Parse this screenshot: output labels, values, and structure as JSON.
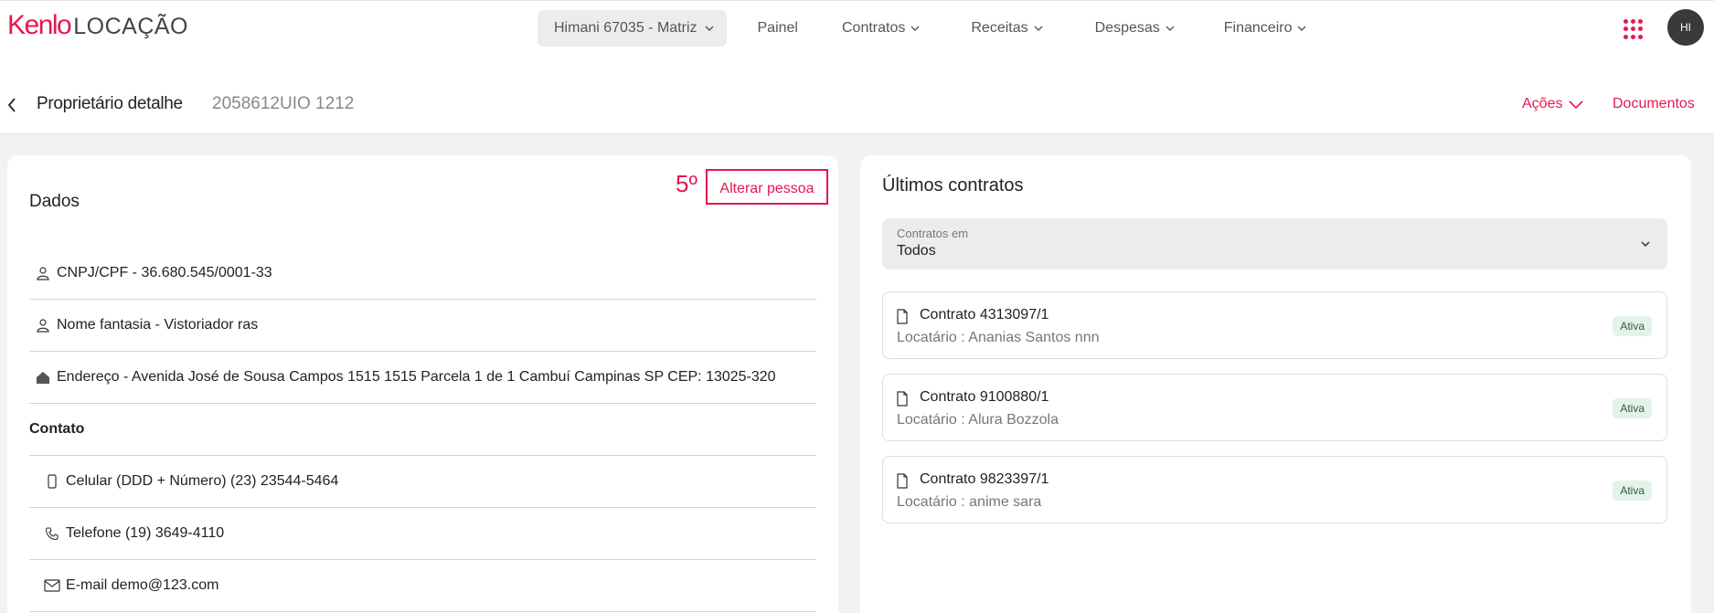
{
  "brand": {
    "name": "Kenlo",
    "product": "LOCAÇÃO"
  },
  "nav": {
    "branch": "Himani 67035 - Matriz",
    "items": [
      "Painel",
      "Contratos",
      "Receitas",
      "Despesas",
      "Financeiro"
    ]
  },
  "user": {
    "initials": "HI"
  },
  "header": {
    "title": "Proprietário detalhe",
    "code": "2058612UIO 1212",
    "actions_label": "Ações",
    "documents_label": "Documentos"
  },
  "dados": {
    "title": "Dados",
    "step": "5º",
    "change_person": "Alterar pessoa",
    "cnpj": "CNPJ/CPF - 36.680.545/0001-33",
    "nome_fantasia": "Nome fantasia - Vistoriador ras",
    "endereco": "Endereço - Avenida José de Sousa Campos 1515 1515 Parcela 1 de 1 Cambuí Campinas SP CEP: 13025-320",
    "contato_title": "Contato",
    "celular": "Celular (DDD + Número) (23) 23544-5464",
    "telefone": "Telefone (19) 3649-4110",
    "email": "E-mail demo@123.com"
  },
  "contracts": {
    "title": "Últimos contratos",
    "filter_label": "Contratos em",
    "filter_value": "Todos",
    "items": [
      {
        "name": "Contrato 4313097/1",
        "tenant": "Locatário : Ananias Santos nnn",
        "status": "Ativa"
      },
      {
        "name": "Contrato 9100880/1",
        "tenant": "Locatário : Alura Bozzola",
        "status": "Ativa"
      },
      {
        "name": "Contrato 9823397/1",
        "tenant": "Locatário : anime sara",
        "status": "Ativa"
      }
    ]
  },
  "colors": {
    "accent": "#e5184f",
    "badge_bg": "#e4f3ea"
  }
}
